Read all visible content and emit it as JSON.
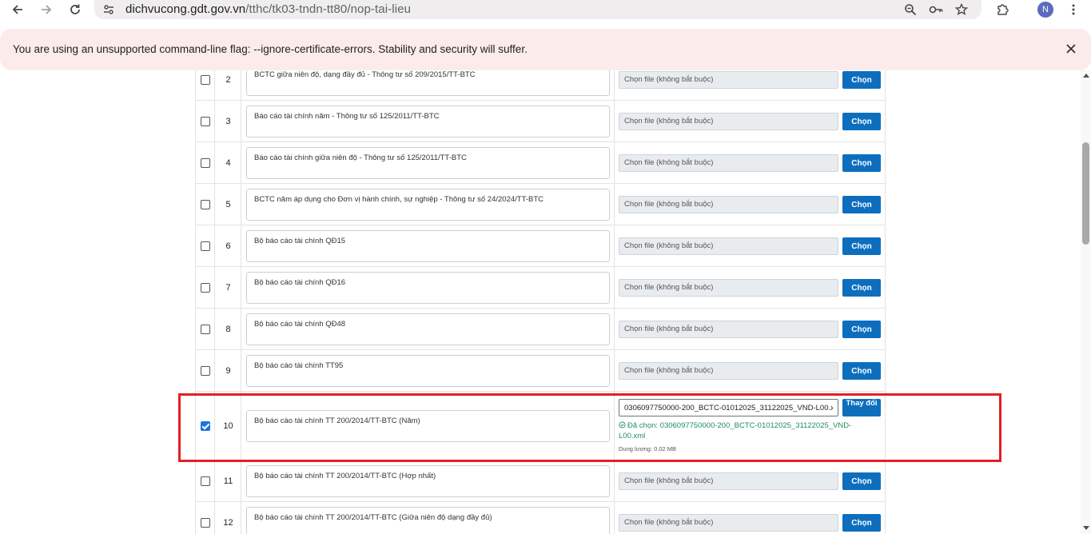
{
  "browser": {
    "url_domain": "dichvucong.gdt.gov.vn",
    "url_path": "/tthc/tk03-tndn-tt80/nop-tai-lieu",
    "profile_initial": "N"
  },
  "infobar": {
    "message": "You are using an unsupported command-line flag: --ignore-certificate-errors. Stability and security will suffer."
  },
  "rows": [
    {
      "stt": "2",
      "name": "BCTC giữa niên độ, dạng đầy đủ - Thông tư số 209/2015/TT-BTC",
      "file_placeholder": "Chọn file (không bắt buộc)",
      "button": "Chọn",
      "checked": false
    },
    {
      "stt": "3",
      "name": "Báo cáo tài chính năm - Thông tư số 125/2011/TT-BTC",
      "file_placeholder": "Chọn file (không bắt buộc)",
      "button": "Chọn",
      "checked": false
    },
    {
      "stt": "4",
      "name": "Báo cáo tài chính giữa niên độ - Thông tư số 125/2011/TT-BTC",
      "file_placeholder": "Chọn file (không bắt buộc)",
      "button": "Chọn",
      "checked": false
    },
    {
      "stt": "5",
      "name": "BCTC năm áp dụng cho Đơn vị hành chính, sự nghiệp - Thông tư số 24/2024/TT-BTC",
      "file_placeholder": "Chọn file (không bắt buộc)",
      "button": "Chọn",
      "checked": false
    },
    {
      "stt": "6",
      "name": "Bộ báo cáo tài chính QĐ15",
      "file_placeholder": "Chọn file (không bắt buộc)",
      "button": "Chọn",
      "checked": false
    },
    {
      "stt": "7",
      "name": "Bộ báo cáo tài chính QĐ16",
      "file_placeholder": "Chọn file (không bắt buộc)",
      "button": "Chọn",
      "checked": false
    },
    {
      "stt": "8",
      "name": "Bộ báo cáo tài chính QĐ48",
      "file_placeholder": "Chọn file (không bắt buộc)",
      "button": "Chọn",
      "checked": false
    },
    {
      "stt": "9",
      "name": "Bộ báo cáo tài chính TT95",
      "file_placeholder": "Chọn file (không bắt buộc)",
      "button": "Chọn",
      "checked": false
    },
    {
      "stt": "10",
      "name": "Bộ báo cáo tài chính TT 200/2014/TT-BTC (Năm)",
      "file_value": "0306097750000-200_BCTC-01012025_31122025_VND-L00.xml",
      "button": "Thay đổi",
      "selected_label": "Đã chọn: 0306097750000-200_BCTC-01012025_31122025_VND-L00.xml",
      "size_label": "Dung lượng: 0.02 MB",
      "checked": true
    },
    {
      "stt": "11",
      "name": "Bộ báo cáo tài chính TT 200/2014/TT-BTC (Hợp nhất)",
      "file_placeholder": "Chọn file (không bắt buộc)",
      "button": "Chọn",
      "checked": false
    },
    {
      "stt": "12",
      "name": "Bộ báo cáo tài chính TT 200/2014/TT-BTC (Giữa niên độ dạng đầy đủ)",
      "file_placeholder": "Chọn file (không bắt buộc)",
      "button": "Chọn",
      "checked": false
    }
  ],
  "icons": {
    "back": "arrow-left-icon",
    "forward": "arrow-right-icon",
    "reload": "reload-icon",
    "site_info": "tune-icon",
    "zoom": "zoom-icon",
    "password": "key-icon",
    "bookmark": "star-icon",
    "extensions": "puzzle-icon",
    "menu": "kebab-menu-icon",
    "close": "close-icon",
    "check_circle": "check-circle-icon"
  },
  "colors": {
    "primary_button": "#0d6ebe",
    "highlight_border": "#e41e26",
    "success_text": "#1e8e5a",
    "infobar_bg": "#fbeceb"
  }
}
